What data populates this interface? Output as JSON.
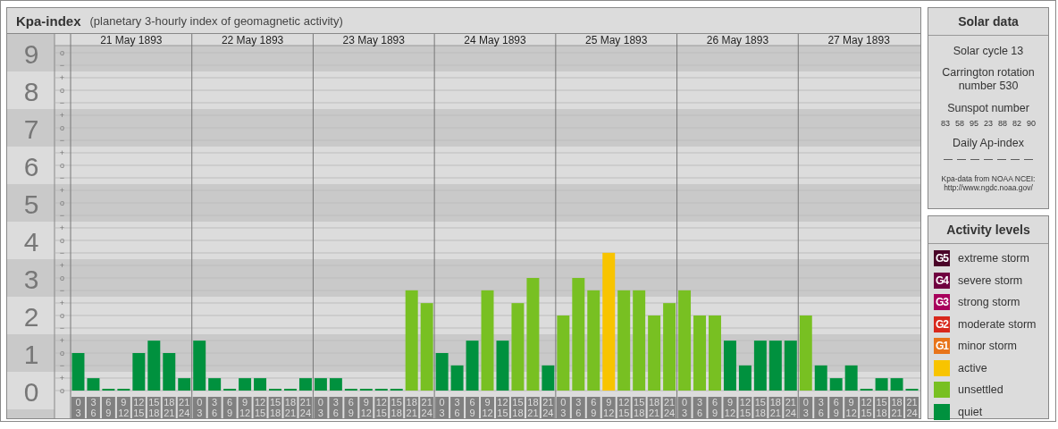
{
  "main_panel": {
    "title": "Kpa-index",
    "subtitle": "(planetary 3-hourly index of geomagnetic activity)",
    "day_labels": [
      "21 May 1893",
      "22 May 1893",
      "23 May 1893",
      "24 May 1893",
      "25 May 1893",
      "26 May 1893",
      "27 May 1893"
    ],
    "scale_marks": [
      "o",
      "−",
      "+",
      "o",
      "−",
      "+",
      "o",
      "−",
      "+",
      "o",
      "−",
      "+",
      "o",
      "−",
      "+",
      "o",
      "−",
      "+",
      "o",
      "−",
      "+",
      "o",
      "−",
      "+",
      "o",
      "−",
      "+",
      "o"
    ],
    "chart_data": {
      "type": "bar",
      "grid": true,
      "ylim": [
        0,
        9
      ],
      "yticks": [
        {
          "value": 9,
          "label": "9"
        },
        {
          "value": 8,
          "label": "8"
        },
        {
          "value": 7,
          "label": "7"
        },
        {
          "value": 6,
          "label": "6"
        },
        {
          "value": 5,
          "label": "5"
        },
        {
          "value": 4,
          "label": "4"
        },
        {
          "value": 3,
          "label": "3"
        },
        {
          "value": 2,
          "label": "2"
        },
        {
          "value": 1,
          "label": "1"
        },
        {
          "value": 0,
          "label": "0"
        }
      ],
      "categories": [
        "0\n3",
        "3\n6",
        "6\n9",
        "9\n12",
        "12\n15",
        "15\n18",
        "18\n21",
        "21\n24",
        "0\n3",
        "3\n6",
        "6\n9",
        "9\n12",
        "12\n15",
        "15\n18",
        "18\n21",
        "21\n24",
        "0\n3",
        "3\n6",
        "6\n9",
        "9\n12",
        "12\n15",
        "15\n18",
        "18\n21",
        "21\n24",
        "0\n3",
        "3\n6",
        "6\n9",
        "9\n12",
        "12\n15",
        "15\n18",
        "18\n21",
        "21\n24",
        "0\n3",
        "3\n6",
        "6\n9",
        "9\n12",
        "12\n15",
        "15\n18",
        "18\n21",
        "21\n24",
        "0\n3",
        "3\n6",
        "6\n9",
        "9\n12",
        "12\n15",
        "15\n18",
        "18\n21",
        "21\n24",
        "0\n3",
        "3\n6",
        "6\n9",
        "9\n12",
        "12\n15",
        "15\n18",
        "18\n21",
        "21\n24"
      ],
      "series": [
        {
          "name": "quiet",
          "color": "#00913e",
          "values": [
            1,
            0.33,
            0,
            0,
            1,
            1.33,
            1,
            0.33,
            1.33,
            0.33,
            0,
            0.33,
            0.33,
            0,
            0,
            0.33,
            0.33,
            0.33,
            0,
            0,
            0,
            0,
            null,
            null,
            1,
            0.67,
            1.33,
            null,
            1.33,
            null,
            null,
            0.67,
            null,
            null,
            null,
            null,
            null,
            null,
            null,
            null,
            null,
            null,
            null,
            1.33,
            0.67,
            1.33,
            1.33,
            1.33,
            null,
            0.67,
            0.33,
            0.67,
            0,
            0.33,
            0.33,
            0
          ]
        },
        {
          "name": "unsettled",
          "color": "#78c022",
          "values": [
            null,
            null,
            null,
            null,
            null,
            null,
            null,
            null,
            null,
            null,
            null,
            null,
            null,
            null,
            null,
            null,
            null,
            null,
            null,
            null,
            null,
            null,
            2.67,
            2.33,
            null,
            null,
            null,
            2.67,
            null,
            2.33,
            3,
            null,
            2,
            3,
            2.67,
            null,
            2.67,
            2.67,
            2,
            2.33,
            2.67,
            2,
            2,
            null,
            null,
            null,
            null,
            null,
            2,
            null,
            null,
            null,
            null,
            null,
            null,
            null
          ]
        },
        {
          "name": "active",
          "color": "#f8c400",
          "values": [
            null,
            null,
            null,
            null,
            null,
            null,
            null,
            null,
            null,
            null,
            null,
            null,
            null,
            null,
            null,
            null,
            null,
            null,
            null,
            null,
            null,
            null,
            null,
            null,
            null,
            null,
            null,
            null,
            null,
            null,
            null,
            null,
            null,
            null,
            null,
            3.67,
            null,
            null,
            null,
            null,
            null,
            null,
            null,
            null,
            null,
            null,
            null,
            null,
            null,
            null,
            null,
            null,
            null,
            null,
            null,
            null
          ]
        }
      ]
    }
  },
  "solar_data": {
    "title": "Solar data",
    "solar_cycle": "Solar cycle 13",
    "carrington": "Carrington rotation number 530",
    "sunspot_title": "Sunspot number",
    "sunspot_numbers": [
      "83",
      "58",
      "95",
      "23",
      "88",
      "82",
      "90"
    ],
    "ap_title": "Daily Ap-index",
    "ap_values": [
      "—",
      "—",
      "—",
      "—",
      "—",
      "—",
      "—"
    ],
    "source": "Kpa-data from NOAA NCEI:",
    "source_url": "http://www.ngdc.noaa.gov/"
  },
  "activity_levels": {
    "title": "Activity levels",
    "items": [
      {
        "badge": "G5",
        "label": "extreme storm",
        "color": "#4a0428"
      },
      {
        "badge": "G4",
        "label": "severe storm",
        "color": "#700040"
      },
      {
        "badge": "G3",
        "label": "strong storm",
        "color": "#a8005c"
      },
      {
        "badge": "G2",
        "label": "moderate storm",
        "color": "#d8281c"
      },
      {
        "badge": "G1",
        "label": "minor storm",
        "color": "#e8741a"
      }
    ]
  }
}
